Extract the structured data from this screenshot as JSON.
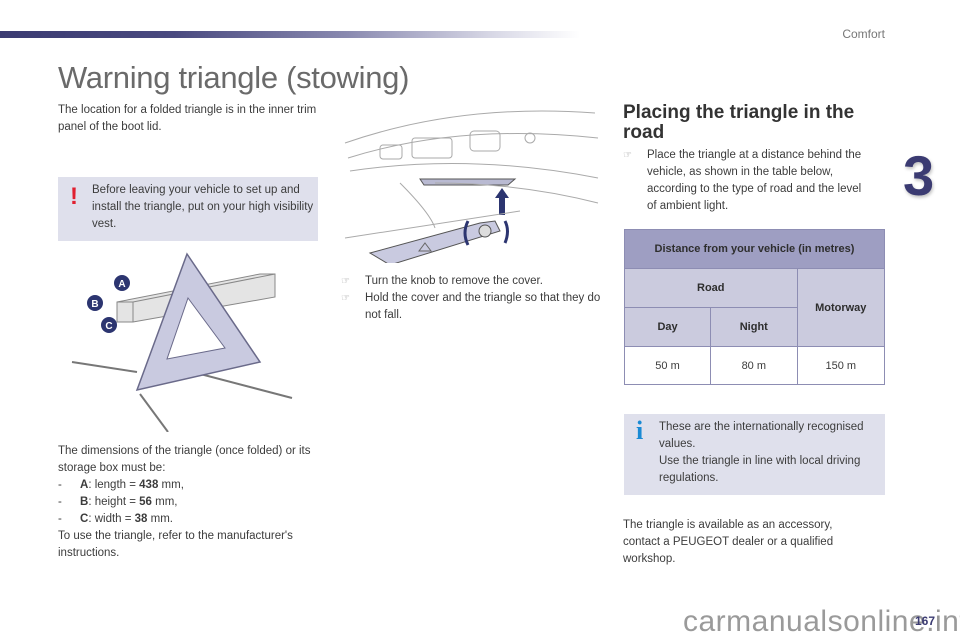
{
  "header": {
    "section": "Comfort",
    "chapter": "3",
    "accent_color": "#3b3b72"
  },
  "page": {
    "title": "Warning triangle (stowing)",
    "number": "167",
    "watermark": "carmanualsonline.info"
  },
  "left": {
    "intro": "The location for a folded triangle is in the inner trim panel of the boot lid.",
    "warning": {
      "icon": "exclamation-icon",
      "text": "Before leaving your vehicle to set up and install the triangle, put on your high visibility vest."
    },
    "illustration": {
      "labels": [
        "A",
        "B",
        "C"
      ]
    },
    "dimensions": {
      "intro": "The dimensions of the triangle (once folded) or its storage box must be:",
      "items": [
        {
          "dash": "-",
          "key": "A",
          "label": ": length = ",
          "value": "438",
          "unit": " mm,"
        },
        {
          "dash": "-",
          "key": "B",
          "label": ": height = ",
          "value": "56",
          "unit": " mm,"
        },
        {
          "dash": "-",
          "key": "C",
          "label": ": width = ",
          "value": "38",
          "unit": " mm."
        }
      ],
      "outro": "To use the triangle, refer to the manufacturer's instructions."
    }
  },
  "middle": {
    "steps": [
      "Turn the knob to remove the cover.",
      "Hold the cover and the triangle so that they do not fall."
    ]
  },
  "right": {
    "heading": "Placing the triangle in the road",
    "step": "Place the triangle at a distance behind the vehicle, as shown in the table below, according to the type of road and the level of ambient light.",
    "table": {
      "caption": "Distance from your vehicle (in metres)",
      "road": "Road",
      "motorway": "Motorway",
      "day": "Day",
      "night": "Night",
      "values": [
        "50 m",
        "80 m",
        "150 m"
      ]
    },
    "info": {
      "icon": "info-icon",
      "line1": "These are the internationally recognised values.",
      "line2": "Use the triangle in line with local driving regulations."
    },
    "accessory": "The triangle is available as an accessory, contact a PEUGEOT dealer or a qualified workshop."
  }
}
